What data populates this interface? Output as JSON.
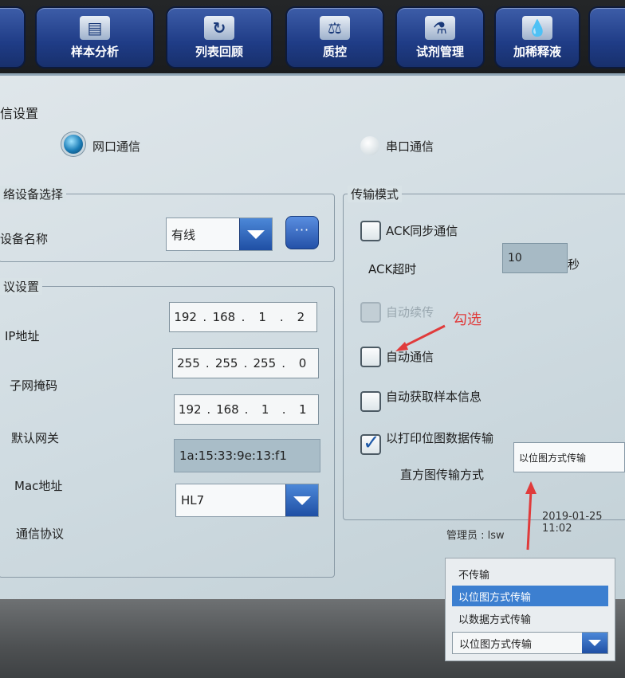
{
  "nav": {
    "items": [
      {
        "label": "",
        "icon": "partial-icon"
      },
      {
        "label": "样本分析",
        "icon": "document-chart-icon"
      },
      {
        "label": "列表回顾",
        "icon": "refresh-icon"
      },
      {
        "label": "质控",
        "icon": "balance-scale-icon"
      },
      {
        "label": "试剂管理",
        "icon": "bottles-icon"
      },
      {
        "label": "加稀释液",
        "icon": "drop-icon"
      },
      {
        "label": "",
        "icon": "partial-icon"
      }
    ]
  },
  "comm": {
    "title": "信设置",
    "network_label": "网口通信",
    "serial_label": "串口通信",
    "selected": "network"
  },
  "device": {
    "group_title": "络设备选择",
    "name_label": "设备名称",
    "name_value": "有线",
    "more_label": "···"
  },
  "protocol": {
    "group_title": "议设置",
    "ip_label": "IP地址",
    "ip": [
      "192",
      "168",
      "1",
      "2"
    ],
    "mask_label": "子网掩码",
    "mask": [
      "255",
      "255",
      "255",
      "0"
    ],
    "gateway_label": "默认网关",
    "gateway": [
      "192",
      "168",
      "1",
      "1"
    ],
    "mac_label": "Mac地址",
    "mac_value": "1a:15:33:9e:13:f1",
    "proto_label": "通信协议",
    "proto_value": "HL7",
    "dot": "."
  },
  "transfer": {
    "group_title": "传输模式",
    "ack_sync_label": "ACK同步通信",
    "ack_sync_checked": false,
    "ack_timeout_label": "ACK超时",
    "ack_timeout_value": "10",
    "ack_timeout_unit": "秒",
    "auto_resend_label": "自动续传",
    "auto_comm_label": "自动通信",
    "auto_comm_checked": false,
    "auto_fetch_label": "自动获取样本信息",
    "auto_fetch_checked": false,
    "print_bitmap_label": "以打印位图数据传输",
    "print_bitmap_checked": true,
    "histogram_label": "直方图传输方式",
    "histogram_value": "以位图方式传输"
  },
  "annotation": {
    "text": "勾选",
    "color": "#e03b3b"
  },
  "footer": {
    "admin": "管理员 : lsw",
    "datetime": "2019-01-25 11:02"
  },
  "popup": {
    "options": [
      "不传输",
      "以位图方式传输",
      "以数据方式传输"
    ],
    "selected_index": 1,
    "combo_value": "以位图方式传输"
  },
  "colors": {
    "accent": "#1f4fa4",
    "annotation": "#e03b3b"
  }
}
